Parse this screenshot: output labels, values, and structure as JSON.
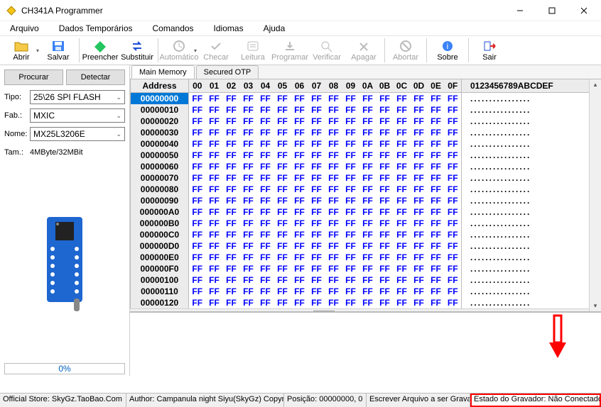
{
  "window": {
    "title": "CH341A Programmer"
  },
  "menu": {
    "arquivo": "Arquivo",
    "dados_temp": "Dados Temporários",
    "comandos": "Comandos",
    "idiomas": "Idiomas",
    "ajuda": "Ajuda"
  },
  "toolbar": {
    "abrir": "Abrir",
    "salvar": "Salvar",
    "preencher": "Preencher",
    "substituir": "Substituir",
    "automatico": "Automático",
    "checar": "Checar",
    "leitura": "Leitura",
    "programar": "Programar",
    "verificar": "Verificar",
    "apagar": "Apagar",
    "abortar": "Abortar",
    "sobre": "Sobre",
    "sair": "Sair"
  },
  "sidebar": {
    "procurar": "Procurar",
    "detectar": "Detectar",
    "tipo_label": "Tipo:",
    "tipo_value": "25\\26 SPI FLASH",
    "fab_label": "Fab.:",
    "fab_value": "MXIC",
    "nome_label": "Nome:",
    "nome_value": "MX25L3206E",
    "tam_label": "Tam.:",
    "tam_value": "4MByte/32MBit",
    "progress": "0%"
  },
  "hex": {
    "tab_main": "Main Memory",
    "tab_otp": "Secured OTP",
    "addr_header": "Address",
    "cols": [
      "00",
      "01",
      "02",
      "03",
      "04",
      "05",
      "06",
      "07",
      "08",
      "09",
      "0A",
      "0B",
      "0C",
      "0D",
      "0E",
      "0F"
    ],
    "ascii_header": "0123456789ABCDEF",
    "rows": [
      "00000000",
      "00000010",
      "00000020",
      "00000030",
      "00000040",
      "00000050",
      "00000060",
      "00000070",
      "00000080",
      "00000090",
      "000000A0",
      "000000B0",
      "000000C0",
      "000000D0",
      "000000E0",
      "000000F0",
      "00000100",
      "00000110",
      "00000120"
    ],
    "byte": "FF",
    "ascii_row": "................"
  },
  "status": {
    "store": "Official Store: SkyGz.TaoBao.Com",
    "author": "Author: Campanula night Siyu(SkyGz) Copyri",
    "pos": "Posição: 00000000, 0",
    "write": "Escrever Arquivo a ser Gravado",
    "conn": "Estado do Gravador: Não Conectado."
  }
}
